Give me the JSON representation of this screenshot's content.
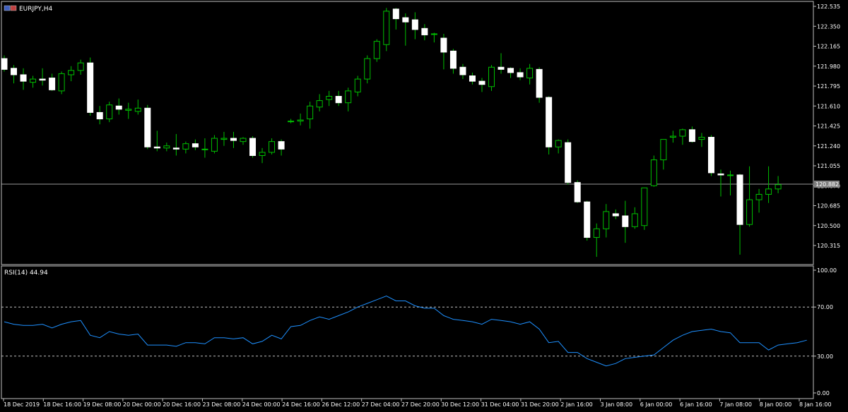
{
  "colors": {
    "background": "#000000",
    "frame": "#c0c0c0",
    "candle_wick": "#00c000",
    "candle_body": "#ffffff",
    "rsi_line": "#1e90ff",
    "level_line": "#c0c0c0",
    "text": "#ffffff"
  },
  "header": {
    "symbol_label": "EURJPY,H4",
    "icon": "chart-window-icon"
  },
  "rsi_panel": {
    "label": "RSI(14) 44.94"
  },
  "current_price": "120.882",
  "chart_data": [
    {
      "type": "candlestick",
      "title": "EURJPY,H4",
      "ylim": [
        120.2,
        122.55
      ],
      "y_ticks": [
        "122.535",
        "122.350",
        "122.165",
        "121.980",
        "121.795",
        "121.610",
        "121.425",
        "121.240",
        "121.055",
        "120.870",
        "120.685",
        "120.500",
        "120.315"
      ],
      "x_tick_labels": [
        "18 Dec 2019",
        "18 Dec 16:00",
        "19 Dec 08:00",
        "20 Dec 00:00",
        "20 Dec 16:00",
        "23 Dec 08:00",
        "24 Dec 00:00",
        "24 Dec 16:00",
        "26 Dec 12:00",
        "27 Dec 04:00",
        "27 Dec 20:00",
        "30 Dec 12:00",
        "31 Dec 04:00",
        "31 Dec 20:00",
        "2 Jan 16:00",
        "3 Jan 08:00",
        "6 Jan 00:00",
        "6 Jan 16:00",
        "7 Jan 08:00",
        "8 Jan 00:00",
        "8 Jan 16:00"
      ],
      "current_price": 120.882,
      "candles": [
        {
          "o": 122.05,
          "h": 122.08,
          "l": 121.93,
          "c": 121.95
        },
        {
          "o": 121.96,
          "h": 121.99,
          "l": 121.82,
          "c": 121.9
        },
        {
          "o": 121.9,
          "h": 121.96,
          "l": 121.76,
          "c": 121.84
        },
        {
          "o": 121.83,
          "h": 121.89,
          "l": 121.78,
          "c": 121.86
        },
        {
          "o": 121.86,
          "h": 121.96,
          "l": 121.8,
          "c": 121.85
        },
        {
          "o": 121.87,
          "h": 121.91,
          "l": 121.75,
          "c": 121.76
        },
        {
          "o": 121.75,
          "h": 121.93,
          "l": 121.72,
          "c": 121.91
        },
        {
          "o": 121.9,
          "h": 121.98,
          "l": 121.84,
          "c": 121.94
        },
        {
          "o": 121.94,
          "h": 122.04,
          "l": 121.9,
          "c": 122.01
        },
        {
          "o": 122.01,
          "h": 122.06,
          "l": 121.52,
          "c": 121.55
        },
        {
          "o": 121.55,
          "h": 121.61,
          "l": 121.44,
          "c": 121.49
        },
        {
          "o": 121.49,
          "h": 121.65,
          "l": 121.46,
          "c": 121.62
        },
        {
          "o": 121.61,
          "h": 121.68,
          "l": 121.53,
          "c": 121.58
        },
        {
          "o": 121.57,
          "h": 121.64,
          "l": 121.49,
          "c": 121.58
        },
        {
          "o": 121.56,
          "h": 121.67,
          "l": 121.53,
          "c": 121.59
        },
        {
          "o": 121.59,
          "h": 121.62,
          "l": 121.21,
          "c": 121.23
        },
        {
          "o": 121.23,
          "h": 121.38,
          "l": 121.19,
          "c": 121.22
        },
        {
          "o": 121.22,
          "h": 121.27,
          "l": 121.19,
          "c": 121.24
        },
        {
          "o": 121.22,
          "h": 121.35,
          "l": 121.15,
          "c": 121.21
        },
        {
          "o": 121.21,
          "h": 121.28,
          "l": 121.17,
          "c": 121.26
        },
        {
          "o": 121.26,
          "h": 121.3,
          "l": 121.2,
          "c": 121.23
        },
        {
          "o": 121.21,
          "h": 121.31,
          "l": 121.13,
          "c": 121.21
        },
        {
          "o": 121.19,
          "h": 121.34,
          "l": 121.17,
          "c": 121.31
        },
        {
          "o": 121.3,
          "h": 121.37,
          "l": 121.24,
          "c": 121.31
        },
        {
          "o": 121.31,
          "h": 121.37,
          "l": 121.22,
          "c": 121.29
        },
        {
          "o": 121.28,
          "h": 121.32,
          "l": 121.25,
          "c": 121.31
        },
        {
          "o": 121.31,
          "h": 121.33,
          "l": 121.13,
          "c": 121.15
        },
        {
          "o": 121.15,
          "h": 121.22,
          "l": 121.08,
          "c": 121.18
        },
        {
          "o": 121.18,
          "h": 121.31,
          "l": 121.16,
          "c": 121.28
        },
        {
          "o": 121.28,
          "h": 121.3,
          "l": 121.15,
          "c": 121.21
        },
        {
          "o": 121.47,
          "h": 121.49,
          "l": 121.45,
          "c": 121.47
        },
        {
          "o": 121.47,
          "h": 121.54,
          "l": 121.43,
          "c": 121.48
        },
        {
          "o": 121.49,
          "h": 121.65,
          "l": 121.4,
          "c": 121.61
        },
        {
          "o": 121.6,
          "h": 121.72,
          "l": 121.56,
          "c": 121.66
        },
        {
          "o": 121.67,
          "h": 121.75,
          "l": 121.61,
          "c": 121.7
        },
        {
          "o": 121.7,
          "h": 121.75,
          "l": 121.61,
          "c": 121.64
        },
        {
          "o": 121.64,
          "h": 121.78,
          "l": 121.56,
          "c": 121.75
        },
        {
          "o": 121.74,
          "h": 121.89,
          "l": 121.7,
          "c": 121.86
        },
        {
          "o": 121.86,
          "h": 122.08,
          "l": 121.82,
          "c": 122.05
        },
        {
          "o": 122.05,
          "h": 122.23,
          "l": 122.02,
          "c": 122.21
        },
        {
          "o": 122.18,
          "h": 122.52,
          "l": 122.12,
          "c": 122.49
        },
        {
          "o": 122.51,
          "h": 122.52,
          "l": 122.32,
          "c": 122.42
        },
        {
          "o": 122.43,
          "h": 122.47,
          "l": 122.17,
          "c": 122.39
        },
        {
          "o": 122.41,
          "h": 122.48,
          "l": 122.23,
          "c": 122.32
        },
        {
          "o": 122.33,
          "h": 122.37,
          "l": 122.22,
          "c": 122.27
        },
        {
          "o": 122.28,
          "h": 122.29,
          "l": 122.2,
          "c": 122.28
        },
        {
          "o": 122.24,
          "h": 122.28,
          "l": 121.95,
          "c": 122.11
        },
        {
          "o": 122.12,
          "h": 122.14,
          "l": 121.91,
          "c": 121.96
        },
        {
          "o": 121.97,
          "h": 122.0,
          "l": 121.86,
          "c": 121.9
        },
        {
          "o": 121.89,
          "h": 121.92,
          "l": 121.81,
          "c": 121.84
        },
        {
          "o": 121.84,
          "h": 121.87,
          "l": 121.74,
          "c": 121.81
        },
        {
          "o": 121.79,
          "h": 121.99,
          "l": 121.75,
          "c": 121.97
        },
        {
          "o": 121.97,
          "h": 122.1,
          "l": 121.91,
          "c": 121.95
        },
        {
          "o": 121.96,
          "h": 121.97,
          "l": 121.87,
          "c": 121.92
        },
        {
          "o": 121.92,
          "h": 121.96,
          "l": 121.85,
          "c": 121.88
        },
        {
          "o": 121.87,
          "h": 122.0,
          "l": 121.81,
          "c": 121.96
        },
        {
          "o": 121.95,
          "h": 121.97,
          "l": 121.64,
          "c": 121.69
        },
        {
          "o": 121.69,
          "h": 121.7,
          "l": 121.16,
          "c": 121.23
        },
        {
          "o": 121.23,
          "h": 121.3,
          "l": 121.17,
          "c": 121.29
        },
        {
          "o": 121.27,
          "h": 121.3,
          "l": 120.88,
          "c": 120.9
        },
        {
          "o": 120.9,
          "h": 120.92,
          "l": 120.71,
          "c": 120.72
        },
        {
          "o": 120.72,
          "h": 120.73,
          "l": 120.36,
          "c": 120.39
        },
        {
          "o": 120.39,
          "h": 120.52,
          "l": 120.21,
          "c": 120.47
        },
        {
          "o": 120.47,
          "h": 120.7,
          "l": 120.39,
          "c": 120.63
        },
        {
          "o": 120.61,
          "h": 120.65,
          "l": 120.56,
          "c": 120.59
        },
        {
          "o": 120.59,
          "h": 120.73,
          "l": 120.34,
          "c": 120.49
        },
        {
          "o": 120.49,
          "h": 120.67,
          "l": 120.47,
          "c": 120.61
        },
        {
          "o": 120.5,
          "h": 120.85,
          "l": 120.46,
          "c": 120.85
        },
        {
          "o": 120.87,
          "h": 121.15,
          "l": 120.86,
          "c": 121.11
        },
        {
          "o": 121.11,
          "h": 121.29,
          "l": 121.02,
          "c": 121.3
        },
        {
          "o": 121.32,
          "h": 121.38,
          "l": 121.27,
          "c": 121.33
        },
        {
          "o": 121.33,
          "h": 121.4,
          "l": 121.25,
          "c": 121.39
        },
        {
          "o": 121.39,
          "h": 121.42,
          "l": 121.27,
          "c": 121.28
        },
        {
          "o": 121.3,
          "h": 121.36,
          "l": 121.23,
          "c": 121.32
        },
        {
          "o": 121.32,
          "h": 121.34,
          "l": 120.96,
          "c": 120.99
        },
        {
          "o": 120.98,
          "h": 121.02,
          "l": 120.77,
          "c": 120.97
        },
        {
          "o": 120.97,
          "h": 121.01,
          "l": 120.78,
          "c": 120.97
        },
        {
          "o": 120.97,
          "h": 120.98,
          "l": 120.23,
          "c": 120.51
        },
        {
          "o": 120.51,
          "h": 121.05,
          "l": 120.49,
          "c": 120.74
        },
        {
          "o": 120.74,
          "h": 120.84,
          "l": 120.62,
          "c": 120.79
        },
        {
          "o": 120.79,
          "h": 121.05,
          "l": 120.71,
          "c": 120.84
        },
        {
          "o": 120.84,
          "h": 120.96,
          "l": 120.8,
          "c": 120.88
        }
      ]
    },
    {
      "type": "line",
      "title": "RSI(14) 44.94",
      "ylim": [
        0,
        100
      ],
      "y_ticks": [
        "100.00",
        "70.00",
        "30.00",
        "0.00"
      ],
      "levels": [
        70,
        30
      ],
      "values": [
        58,
        56,
        55,
        55,
        56,
        53,
        56,
        58,
        59,
        47,
        45,
        50,
        48,
        47,
        48,
        39,
        39,
        39,
        38,
        41,
        41,
        40,
        45,
        45,
        44,
        45,
        40,
        42,
        47,
        44,
        54,
        55,
        59,
        62,
        60,
        63,
        66,
        70,
        73,
        76,
        79,
        75,
        75,
        71,
        69,
        69,
        63,
        60,
        59,
        58,
        56,
        60,
        59,
        58,
        56,
        58,
        52,
        41,
        42,
        33,
        33,
        28,
        25,
        22,
        24,
        28,
        29,
        30,
        31,
        37,
        43,
        47,
        50,
        51,
        52,
        50,
        49,
        41,
        41,
        41,
        35,
        39,
        40,
        41,
        43
      ]
    }
  ]
}
